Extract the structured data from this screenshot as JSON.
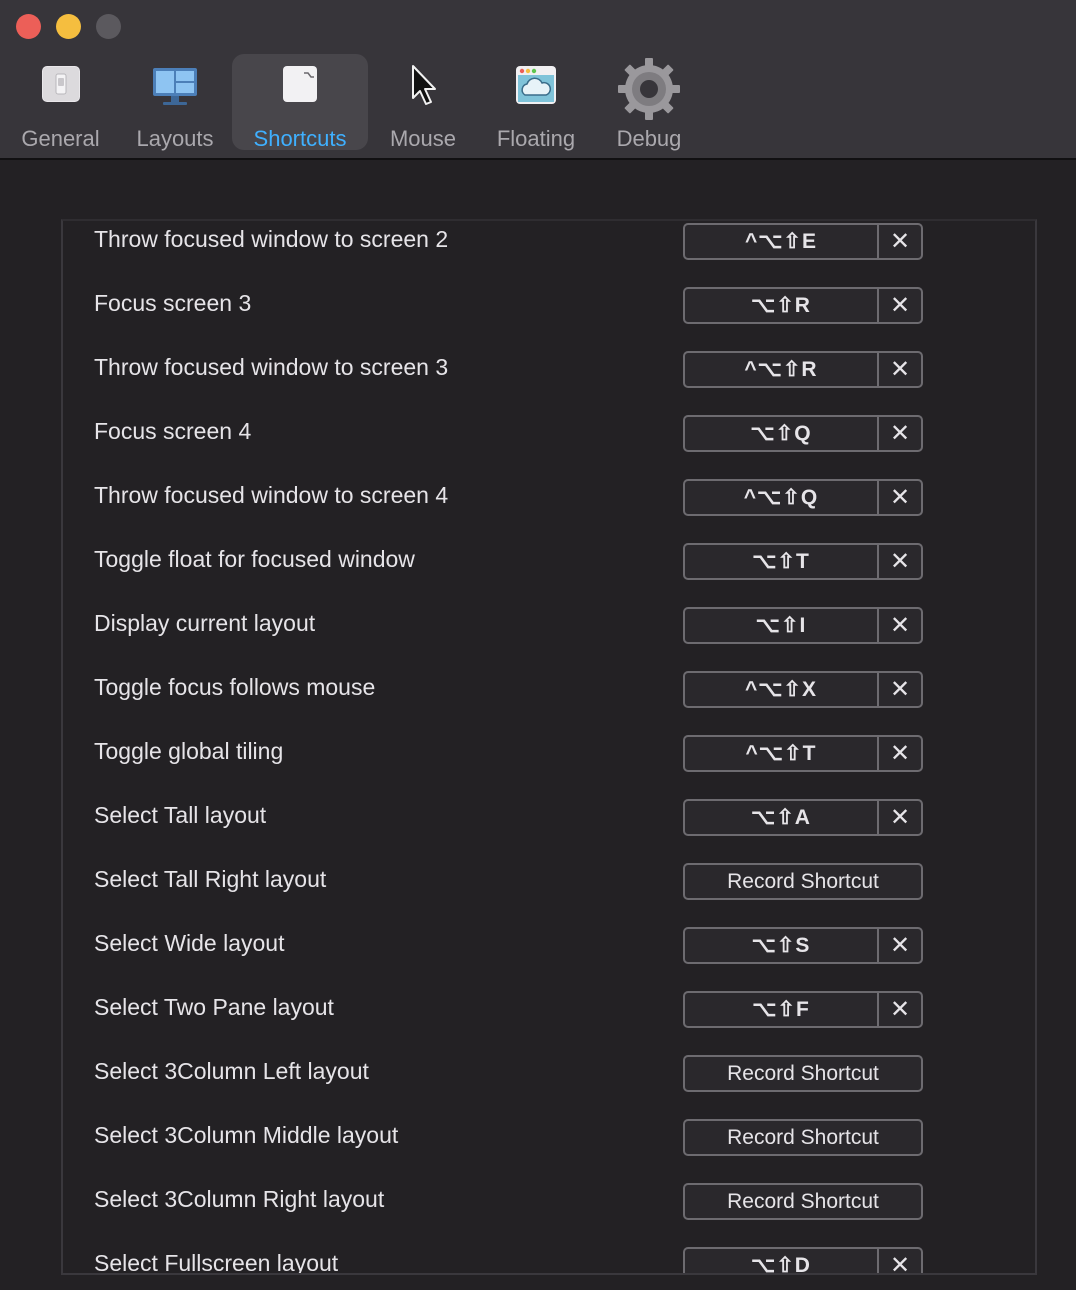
{
  "toolbar": {
    "tabs": [
      {
        "label": "General",
        "icon": "general-switch-icon"
      },
      {
        "label": "Layouts",
        "icon": "layouts-monitor-icon"
      },
      {
        "label": "Shortcuts",
        "icon": "shortcuts-document-icon"
      },
      {
        "label": "Mouse",
        "icon": "mouse-pointer-icon"
      },
      {
        "label": "Floating",
        "icon": "floating-window-icon"
      },
      {
        "label": "Debug",
        "icon": "gear-icon"
      }
    ],
    "active_tab": "Shortcuts"
  },
  "clear_glyph": "✕",
  "colors": {
    "accent": "#3fb0ff",
    "close": "#ec5f58",
    "minimize": "#f5be3f",
    "zoom": "#5b595e"
  },
  "shortcuts": [
    {
      "label": "Throw focused window to screen 2",
      "keys": "^⌥⇧E"
    },
    {
      "label": "Focus screen 3",
      "keys": "⌥⇧R"
    },
    {
      "label": "Throw focused window to screen 3",
      "keys": "^⌥⇧R"
    },
    {
      "label": "Focus screen 4",
      "keys": "⌥⇧Q"
    },
    {
      "label": "Throw focused window to screen 4",
      "keys": "^⌥⇧Q"
    },
    {
      "label": "Toggle float for focused window",
      "keys": "⌥⇧T"
    },
    {
      "label": "Display current layout",
      "keys": "⌥⇧I"
    },
    {
      "label": "Toggle focus follows mouse",
      "keys": "^⌥⇧X"
    },
    {
      "label": "Toggle global tiling",
      "keys": "^⌥⇧T"
    },
    {
      "label": "Select Tall layout",
      "keys": "⌥⇧A"
    },
    {
      "label": "Select Tall Right layout",
      "record": "Record Shortcut"
    },
    {
      "label": "Select Wide layout",
      "keys": "⌥⇧S"
    },
    {
      "label": "Select Two Pane layout",
      "keys": "⌥⇧F"
    },
    {
      "label": "Select 3Column Left layout",
      "record": "Record Shortcut"
    },
    {
      "label": "Select 3Column Middle layout",
      "record": "Record Shortcut"
    },
    {
      "label": "Select 3Column Right layout",
      "record": "Record Shortcut"
    },
    {
      "label": "Select Fullscreen layout",
      "keys": "⌥⇧D"
    }
  ]
}
